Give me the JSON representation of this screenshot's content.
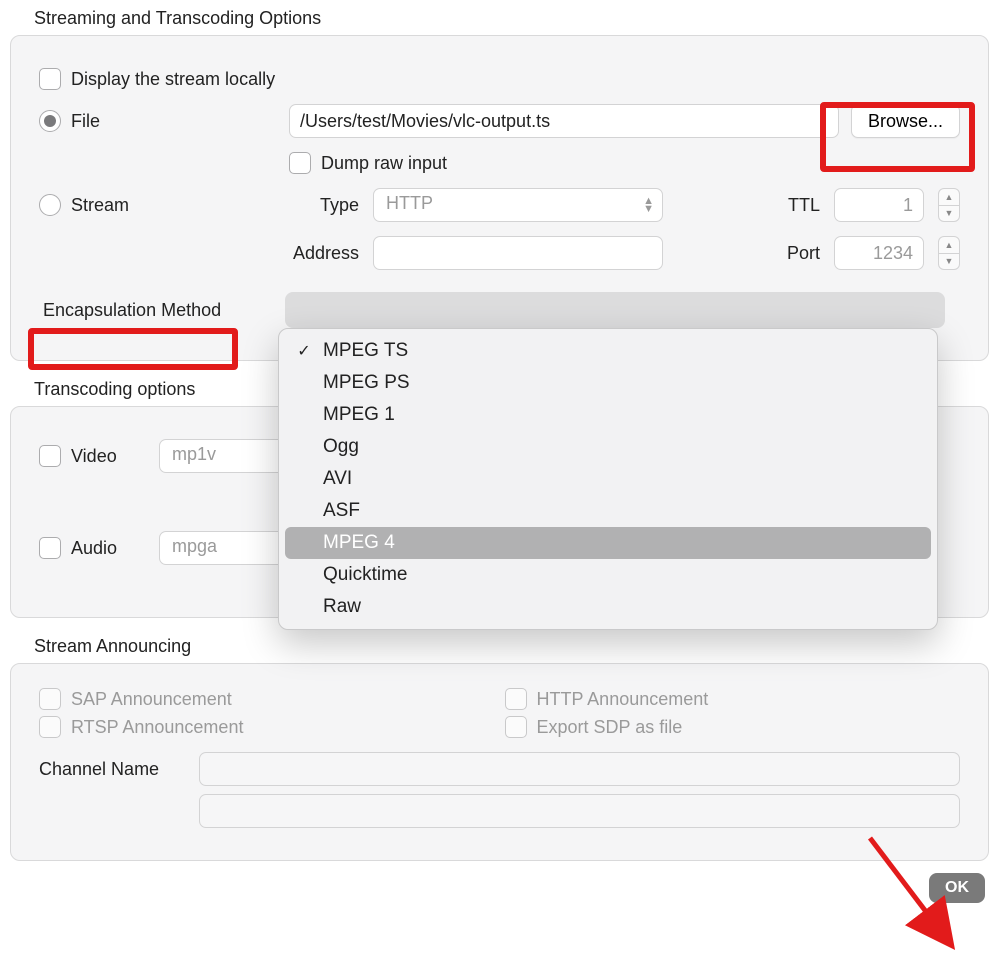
{
  "sections": {
    "streaming_title": "Streaming and Transcoding Options",
    "transcoding_title": "Transcoding options",
    "announcing_title": "Stream Announcing"
  },
  "streaming": {
    "display_locally_label": "Display the stream locally",
    "file_label": "File",
    "file_path": "/Users/test/Movies/vlc-output.ts",
    "browse_label": "Browse...",
    "dump_raw_label": "Dump raw input",
    "stream_label": "Stream",
    "type_label": "Type",
    "type_value": "HTTP",
    "ttl_label": "TTL",
    "ttl_value": "1",
    "address_label": "Address",
    "address_value": "",
    "port_label": "Port",
    "port_value": "1234",
    "encapsulation_label": "Encapsulation Method"
  },
  "encapsulation_menu": {
    "items": [
      {
        "label": "MPEG TS",
        "checked": true
      },
      {
        "label": "MPEG PS"
      },
      {
        "label": "MPEG 1"
      },
      {
        "label": "Ogg"
      },
      {
        "label": "AVI"
      },
      {
        "label": "ASF"
      },
      {
        "label": "MPEG 4",
        "hover": true
      },
      {
        "label": "Quicktime"
      },
      {
        "label": "Raw"
      }
    ]
  },
  "transcoding": {
    "video_label": "Video",
    "video_codec": "mp1v",
    "audio_label": "Audio",
    "audio_codec": "mpga"
  },
  "announcing": {
    "sap_label": "SAP Announcement",
    "http_label": "HTTP Announcement",
    "rtsp_label": "RTSP Announcement",
    "export_sdp_label": "Export SDP as file",
    "channel_name_label": "Channel Name",
    "channel_name_value": ""
  },
  "buttons": {
    "ok_label": "OK"
  },
  "colors": {
    "highlight": "#e21b1b"
  }
}
